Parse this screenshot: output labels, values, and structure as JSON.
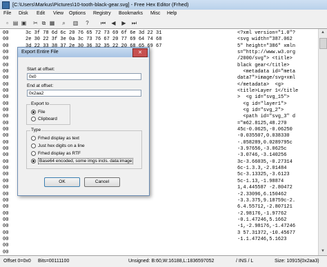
{
  "window": {
    "title": "[C:\\Users\\Markus\\Pictures\\10-tooth-black-gear.svg] - Free Hex Editor (Frhed)"
  },
  "menu": [
    "File",
    "Disk",
    "Edit",
    "View",
    "Options",
    "Registry",
    "Bookmarks",
    "Misc",
    "Help"
  ],
  "toolbar": {
    "icons": [
      "new-icon",
      "open-icon",
      "save-icon",
      "cut-icon",
      "copy-icon",
      "paste-icon",
      "find-icon",
      "properties-icon",
      "help-icon",
      "first-icon",
      "prev-icon",
      "next-icon",
      "last-icon"
    ]
  },
  "rows": [
    {
      "off": "00",
      "hex": "3c 3f 78 6d 6c 20 76 65 72 73 69 6f 6e 3d 22 31",
      "chr": "<?xml version=\"1.0\"?"
    },
    {
      "off": "00",
      "hex": "2e 30 22 3f 3e 0a 3c 73 76 67 20 77 69 64 74 68",
      "chr": "<svg width=\"387.062"
    },
    {
      "off": "00",
      "hex": "3d 22 33 38 37 2e 30 36 32 35 22 20 68 65 69 67",
      "chr": "5\" height=\"386\" xmln"
    },
    {
      "off": "00",
      "hex": "",
      "chr": "s=\"http://www.w3.org"
    },
    {
      "off": "00",
      "hex": "",
      "chr": "/2000/svg\"> <title>"
    },
    {
      "off": "00",
      "hex": "",
      "chr": "black gear</title>"
    },
    {
      "off": "00",
      "hex": "",
      "chr": "  <metadata id=\"meta"
    },
    {
      "off": "00",
      "hex": "",
      "chr": "data7\">image/svg+xml"
    },
    {
      "off": "00",
      "hex": "",
      "chr": "</metadata>  <g>"
    },
    {
      "off": "00",
      "hex": "",
      "chr": "<title>Layer 1</title"
    },
    {
      "off": "00",
      "hex": "",
      "chr": ">  <g id=\"svg_15\">"
    },
    {
      "off": "00",
      "hex": "",
      "chr": "  <g id=\"layer1\">"
    },
    {
      "off": "00",
      "hex": "",
      "chr": "  <g id=\"svg_2\">"
    },
    {
      "off": "00",
      "hex": "",
      "chr": "  <path id=\"svg_3\" d"
    },
    {
      "off": "00",
      "hex": "",
      "chr": "=\"m62.8125,48.270"
    },
    {
      "off": "00",
      "hex": "",
      "chr": "45c-0.0625,-0.06250"
    },
    {
      "off": "00",
      "hex": "",
      "chr": "-0.035507,0.038330"
    },
    {
      "off": "00",
      "hex": "",
      "chr": "-.058289,0.0289795c"
    },
    {
      "off": "00",
      "hex": "",
      "chr": "-3.97656,-3.0625c"
    },
    {
      "off": "00",
      "hex": "",
      "chr": "-3.0746,-3.140256"
    },
    {
      "off": "00",
      "hex": "",
      "chr": "3c-3.66035,-0.27314"
    },
    {
      "off": "00",
      "hex": "",
      "chr": "6c-1.3.3,-2.01484"
    },
    {
      "off": "00",
      "hex": "",
      "chr": "5c-3.13325,-3.6123"
    },
    {
      "off": "00",
      "hex": "",
      "chr": "5c-1.13,-1.98874"
    },
    {
      "off": "00",
      "hex": "",
      "chr": "1,4.445587 -2.80472"
    },
    {
      "off": "00",
      "hex": "",
      "chr": "-2.33096,6.150462"
    },
    {
      "off": "00",
      "hex": "",
      "chr": "-3.3.375,9.18759c-2."
    },
    {
      "off": "00",
      "hex": "",
      "chr": "6.4.55712,-2.807121"
    },
    {
      "off": "00",
      "hex": "",
      "chr": "-2.98176,-1.97762"
    },
    {
      "off": "00",
      "hex": "",
      "chr": "-0.1.47246,5.1662"
    },
    {
      "off": "00",
      "hex": "",
      "chr": "-1,-2.98176,-1.47246"
    },
    {
      "off": "00",
      "hex": "",
      "chr": "3 57.31372,-10.45677"
    },
    {
      "off": "00",
      "hex": "",
      "chr": "-1.1.47246,5.1623"
    },
    {
      "off": "00",
      "hex": "",
      "chr": ""
    },
    {
      "off": "00",
      "hex": "",
      "chr": ""
    }
  ],
  "dialog": {
    "title": "Export Entire File",
    "start_label": "Start at offset:",
    "start_value": "0x0",
    "end_label": "End at offset:",
    "end_value": "0x2aa2",
    "export_group": "Export to",
    "export_file": "File",
    "export_clipboard": "Clipboard",
    "type_group": "Type",
    "type_text": "Frhed display as text",
    "type_hex": "Just hex digits on a line",
    "type_rtf": "Frhed display as RTF",
    "type_base64": "Base64 encoded, some imgs incls. data:image",
    "ok": "OK",
    "cancel": "Cancel"
  },
  "status": {
    "offset": "Offset 0=0x0",
    "bits": "Bits=00111100",
    "unsigned": "Unsigned: B:60,W:16188,L:1836597052",
    "ins": "/ INS / L",
    "size": "Size: 10915(0x2aa3)"
  }
}
